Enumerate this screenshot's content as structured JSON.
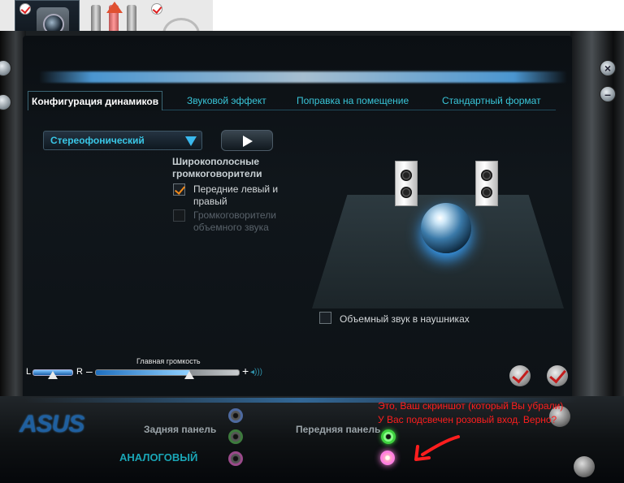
{
  "tabs": {
    "speaker_config": "Конфигурация динамиков",
    "sound_effect": "Звуковой эффект",
    "room_correction": "Поправка на помещение",
    "default_format": "Стандартный формат"
  },
  "speaker_config": {
    "dropdown_value": "Стереофонический",
    "fullrange_title": "Широкополосные громкоговорители",
    "front_lr_label": "Передние левый и правый",
    "front_lr_checked": true,
    "surround_label": "Громкоговорители объемного звука",
    "surround_checked": false,
    "headphone_surround_label": "Объемный звук в наушниках",
    "headphone_surround_checked": false
  },
  "volume": {
    "balance_left": "L",
    "balance_right": "R",
    "minus": "–",
    "title": "Главная громкость",
    "plus": "+",
    "level": 0.65,
    "balance": 0.5
  },
  "bottom": {
    "brand": "ASUS",
    "rear_panel": "Задняя панель",
    "front_panel": "Передняя панель",
    "analog": "АНАЛОГОВЫЙ",
    "note_line1": "Это, Ваш скриншот (который Вы убрали)",
    "note_line2": "У Вас подсвечен розовый вход. Верно?"
  },
  "icons": [
    "webcam-icon",
    "audio-plugs-icon",
    "headset-icon",
    "check-icon",
    "play-icon"
  ],
  "colors": {
    "accent": "#39c6d9",
    "note": "#ff1e1e",
    "asus": "#1f5f9f"
  }
}
